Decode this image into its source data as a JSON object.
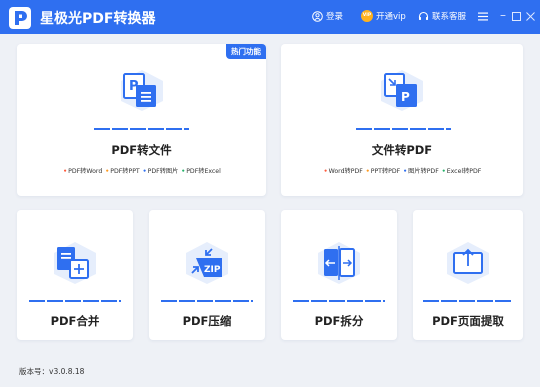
{
  "app": {
    "title": "星极光PDF转换器"
  },
  "titlebar": {
    "login": "登录",
    "vip_badge": "VIP",
    "vip": "开通vip",
    "support": "联系客服"
  },
  "features": {
    "pdf_to_file": {
      "badge": "热门功能",
      "title": "PDF转文件",
      "subs": [
        "PDF转Word",
        "PDF转PPT",
        "PDF转图片",
        "PDF转Excel"
      ]
    },
    "file_to_pdf": {
      "title": "文件转PDF",
      "subs": [
        "Word转PDF",
        "PPT转PDF",
        "图片转PDF",
        "Excel转PDF"
      ]
    },
    "merge": {
      "title": "PDF合并"
    },
    "compress": {
      "title": "PDF压缩",
      "icon_text": "ZIP"
    },
    "split": {
      "title": "PDF拆分"
    },
    "extract": {
      "title": "PDF页面提取"
    }
  },
  "footer": {
    "version": "版本号：v3.0.8.18"
  },
  "colors": {
    "accent": "#2f6ff0",
    "dot_red": "#ff5a3c",
    "dot_orange": "#ff9a1f",
    "dot_blue": "#2f6ff0",
    "dot_green": "#25b36a"
  },
  "icons": {
    "logo": "app-logo-icon",
    "login": "user-icon",
    "vip": "vip-icon",
    "support": "headset-icon",
    "menu": "menu-icon",
    "minimize": "minimize-icon",
    "maximize": "maximize-icon",
    "close": "close-icon"
  }
}
